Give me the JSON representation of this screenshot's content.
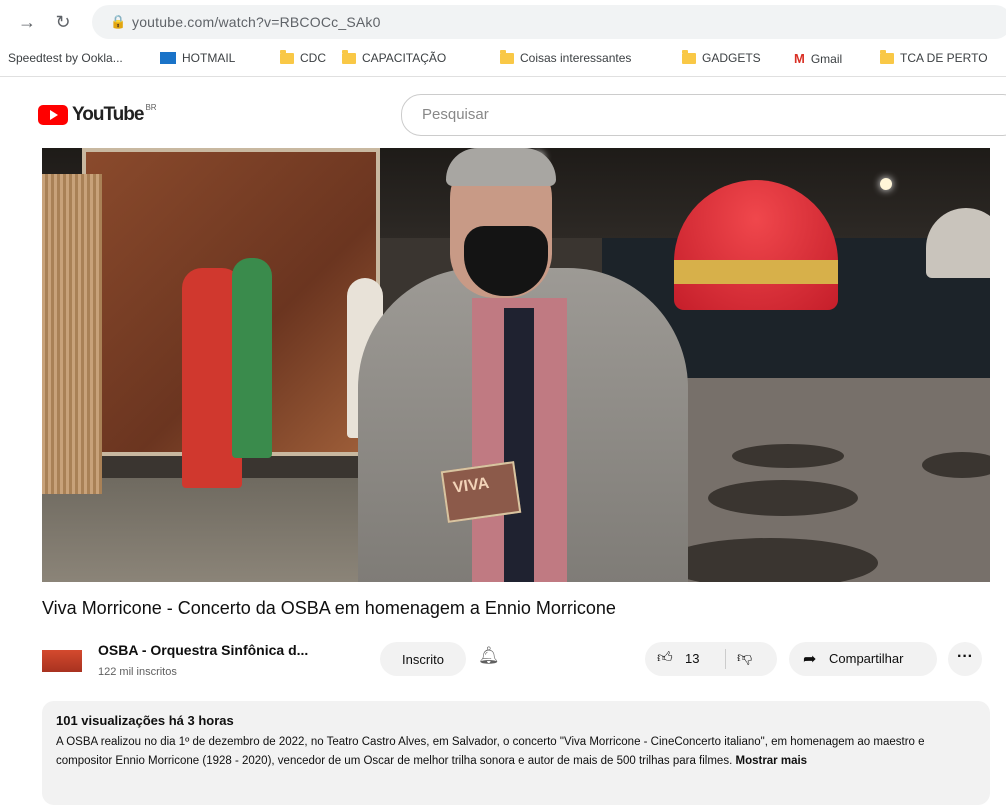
{
  "browser": {
    "url": "youtube.com/watch?v=RBCOCc_SAk0",
    "bookmarks": [
      {
        "label": "Speedtest by Ookla...",
        "icon": "speedtest-icon"
      },
      {
        "label": "HOTMAIL",
        "icon": "hotmail-icon"
      },
      {
        "label": "CDC",
        "icon": "folder-icon"
      },
      {
        "label": "CAPACITAÇÃO",
        "icon": "folder-icon"
      },
      {
        "label": "Coisas interessantes",
        "icon": "folder-icon"
      },
      {
        "label": "GADGETS",
        "icon": "folder-icon"
      },
      {
        "label": "Gmail",
        "icon": "gmail-icon"
      },
      {
        "label": "TCA DE PERTO",
        "icon": "folder-icon"
      }
    ]
  },
  "youtube": {
    "logo_text": "YouTube",
    "logo_sup": "BR",
    "search_placeholder": "Pesquisar"
  },
  "video": {
    "overlay_book_text": "VIVA",
    "title": "Viva Morricone - Concerto da OSBA em homenagem a Ennio Morricone"
  },
  "channel": {
    "name": "OSBA - Orquestra Sinfônica d...",
    "subscribers": "122 mil inscritos",
    "subscribe_label": "Inscrito"
  },
  "actions": {
    "like_count": "13",
    "share_label": "Compartilhar",
    "more_label": "···"
  },
  "description": {
    "meta": "101 visualizações  há 3 horas",
    "text": "A OSBA realizou no dia 1º de dezembro de 2022, no Teatro Castro Alves, em Salvador, o concerto \"Viva Morricone - CineConcerto italiano\", em homenagem ao maestro e compositor Ennio Morricone (1928 - 2020), vencedor de um Oscar de melhor trilha sonora e autor de mais de 500 trilhas para filmes.",
    "more_label": "Mostrar mais"
  },
  "colors": {
    "youtube_red": "#ff0000",
    "pill_bg": "#f2f2f2"
  }
}
